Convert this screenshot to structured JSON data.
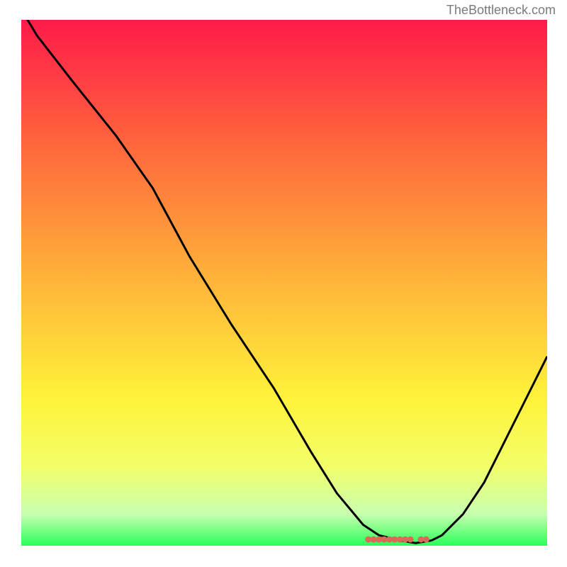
{
  "attribution": "TheBottleneck.com",
  "chart_data": {
    "type": "line",
    "title": "",
    "xlabel": "",
    "ylabel": "",
    "xlim": [
      0,
      100
    ],
    "ylim": [
      0,
      100
    ],
    "gradient_stops": [
      {
        "offset": 0,
        "color": "#ff1a4a"
      },
      {
        "offset": 25,
        "color": "#ff6a3c"
      },
      {
        "offset": 50,
        "color": "#ffb53a"
      },
      {
        "offset": 72,
        "color": "#fff23a"
      },
      {
        "offset": 85,
        "color": "#f2ff6a"
      },
      {
        "offset": 94,
        "color": "#c8ffb0"
      },
      {
        "offset": 100,
        "color": "#2aff5a"
      }
    ],
    "series": [
      {
        "name": "bottleneck-curve",
        "color": "#000000",
        "x": [
          0,
          3,
          10,
          18,
          25,
          32,
          40,
          48,
          55,
          60,
          65,
          68,
          72,
          75,
          78,
          80,
          84,
          88,
          92,
          96,
          100
        ],
        "y": [
          102,
          97,
          88,
          78,
          68,
          55,
          42,
          30,
          18,
          10,
          4,
          2,
          1,
          0.5,
          1,
          2,
          6,
          12,
          20,
          28,
          36
        ]
      }
    ],
    "marker_cluster": {
      "color": "#d96a5a",
      "points_x": [
        66,
        67,
        68,
        69,
        70,
        71,
        72,
        73,
        74,
        76,
        77
      ],
      "y": 1.2
    }
  }
}
